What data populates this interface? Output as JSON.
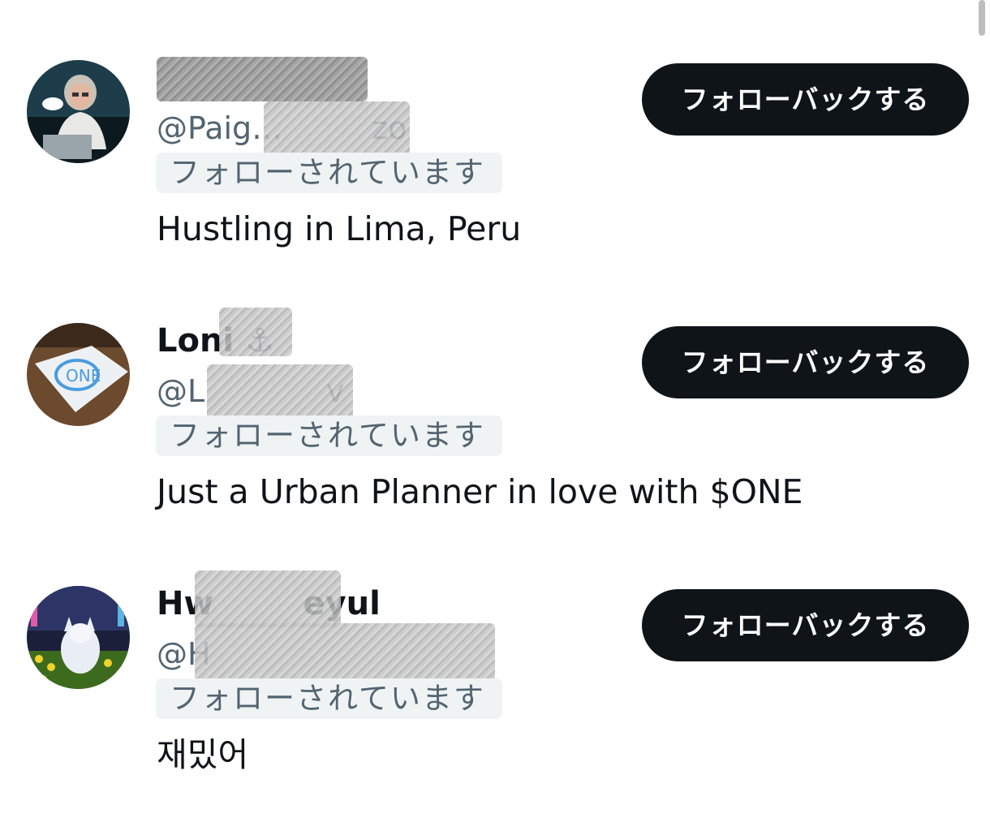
{
  "users": [
    {
      "name": "",
      "handle": "@Paig…",
      "handle_suffix": "zo",
      "follows_you": "フォローされています",
      "bio": "Hustling in Lima, Peru",
      "button": "フォローバックする"
    },
    {
      "name": "Loni",
      "name_emoji": "⚓",
      "handle": "@L",
      "handle_suffix": "v",
      "follows_you": "フォローされています",
      "bio": "Just a Urban Planner in love with $ONE",
      "button": "フォローバックする"
    },
    {
      "name": "Hw",
      "name_suffix": "eyul",
      "handle": "@H",
      "handle_suffix": "",
      "follows_you": "フォローされています",
      "bio": "재밌어",
      "button": "フォローバックする"
    }
  ],
  "colors": {
    "button_bg": "#0f1419",
    "button_text": "#ffffff",
    "secondary_text": "#536471",
    "badge_bg": "#eff3f4"
  },
  "icons": {
    "avatar_1": "avatar-woman-at-computer",
    "avatar_2": "avatar-napkin-drawing",
    "avatar_3": "avatar-white-fox"
  }
}
